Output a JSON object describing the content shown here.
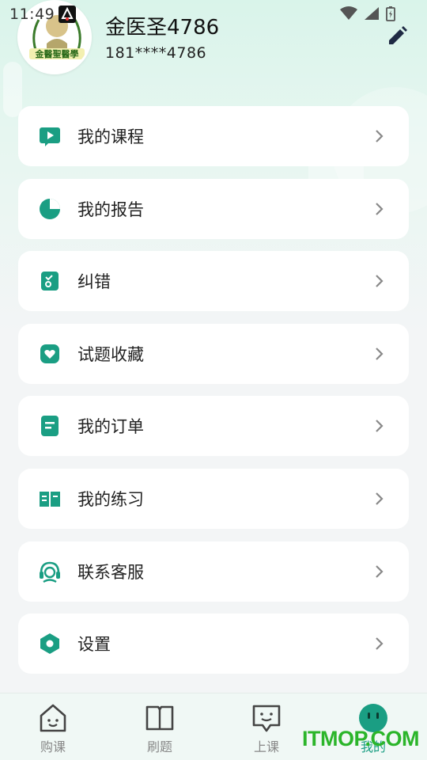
{
  "status_bar": {
    "time": "11:49"
  },
  "profile": {
    "name": "金医圣4786",
    "phone": "181****4786",
    "avatar_text": "金醫聖醫學"
  },
  "menu": [
    {
      "label": "我的课程",
      "icon": "play-icon"
    },
    {
      "label": "我的报告",
      "icon": "pie-chart-icon"
    },
    {
      "label": "纠错",
      "icon": "correction-icon"
    },
    {
      "label": "试题收藏",
      "icon": "heart-icon"
    },
    {
      "label": "我的订单",
      "icon": "order-icon"
    },
    {
      "label": "我的练习",
      "icon": "book-icon"
    },
    {
      "label": "联系客服",
      "icon": "headset-icon"
    },
    {
      "label": "设置",
      "icon": "hexagon-icon"
    }
  ],
  "tabs": [
    {
      "label": "购课",
      "icon": "house-icon"
    },
    {
      "label": "刷题",
      "icon": "book-icon"
    },
    {
      "label": "上课",
      "icon": "chat-icon"
    },
    {
      "label": "我的",
      "icon": "smile-icon",
      "active": true
    }
  ],
  "watermark": "ITMOP.COM",
  "colors": {
    "accent": "#1a9e83",
    "watermark": "#2bb52a"
  }
}
